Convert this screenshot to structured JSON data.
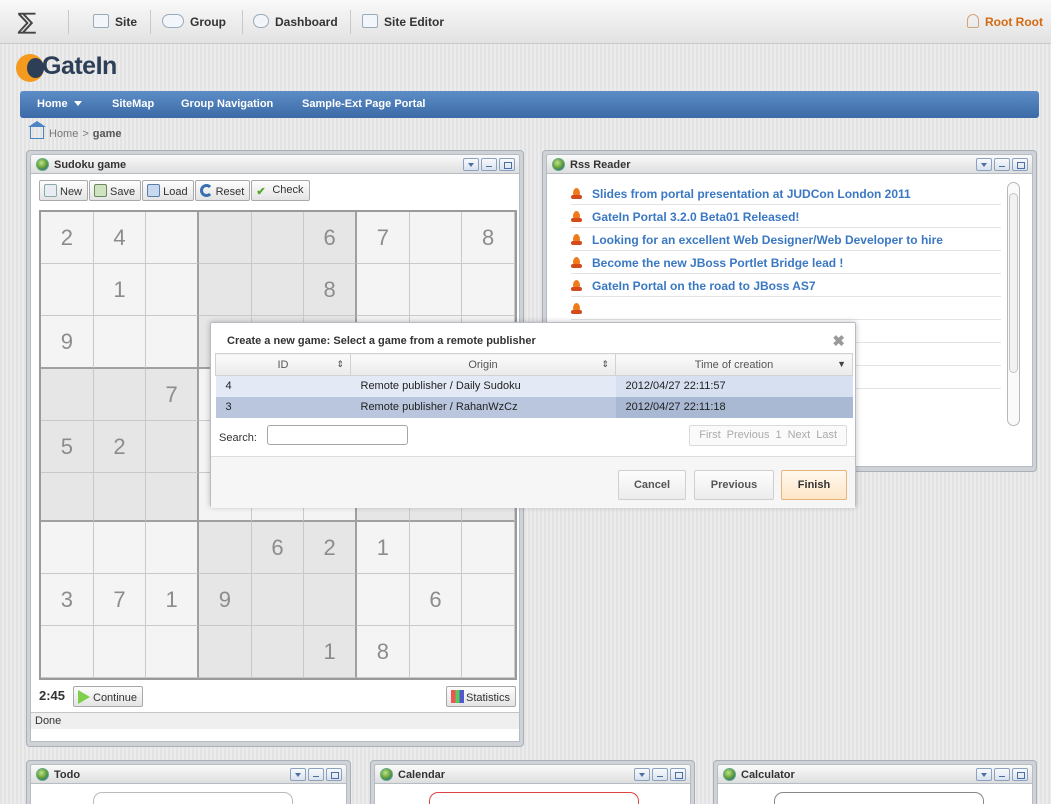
{
  "toolbar": {
    "items": [
      {
        "label": "Site",
        "icon": "site-icon"
      },
      {
        "label": "Group",
        "icon": "group-icon"
      },
      {
        "label": "Dashboard",
        "icon": "dashboard-icon"
      },
      {
        "label": "Site Editor",
        "icon": "site-editor-icon"
      }
    ],
    "user": "Root Root"
  },
  "brand": {
    "name": "GateIn"
  },
  "nav": {
    "items": [
      "Home",
      "SiteMap",
      "Group Navigation",
      "Sample-Ext Page Portal"
    ]
  },
  "breadcrumb": {
    "home": "Home",
    "separator": ">",
    "current": "game"
  },
  "sudoku": {
    "title": "Sudoku game",
    "buttons": [
      "New",
      "Save",
      "Load",
      "Reset",
      "Check"
    ],
    "grid": [
      [
        "2",
        "4",
        "",
        "",
        "",
        "6",
        "7",
        "",
        "8"
      ],
      [
        "",
        "1",
        "",
        "",
        "",
        "8",
        "",
        "",
        ""
      ],
      [
        "9",
        "",
        "",
        "",
        "",
        "",
        "",
        "",
        ""
      ],
      [
        "",
        "",
        "7",
        "",
        "",
        "",
        "",
        "",
        ""
      ],
      [
        "5",
        "2",
        "",
        "",
        "",
        "",
        "",
        "",
        ""
      ],
      [
        "",
        "",
        "",
        "",
        "",
        "",
        "",
        "",
        ""
      ],
      [
        "",
        "",
        "",
        "",
        "6",
        "2",
        "1",
        "",
        ""
      ],
      [
        "3",
        "7",
        "1",
        "9",
        "",
        "",
        "",
        "6",
        ""
      ],
      [
        "",
        "",
        "",
        "",
        "",
        "1",
        "8",
        "",
        ""
      ]
    ],
    "timer": "2:45",
    "continue_label": "Continue",
    "statistics_label": "Statistics",
    "status": "Done"
  },
  "rss": {
    "title": "Rss Reader",
    "items": [
      "Slides from portal presentation at JUDCon London 2011",
      "GateIn Portal 3.2.0 Beta01 Released!",
      "Looking for an excellent Web Designer/Web Developer to hire",
      "Become the new JBoss Portlet Bridge lead !",
      "GateIn Portal on the road to JBoss AS7",
      "",
      "ease!",
      "",
      "ter Developer?"
    ]
  },
  "bottom_portlets": [
    {
      "title": "Todo"
    },
    {
      "title": "Calendar"
    },
    {
      "title": "Calculator"
    }
  ],
  "modal": {
    "title": "Create a new game: Select a game from a remote publisher",
    "columns": [
      "ID",
      "Origin",
      "Time of creation"
    ],
    "rows": [
      {
        "id": "4",
        "origin": "Remote publisher / Daily Sudoku",
        "time": "2012/04/27 22:11:57"
      },
      {
        "id": "3",
        "origin": "Remote publisher / RahanWzCz",
        "time": "2012/04/27 22:11:18"
      }
    ],
    "search_label": "Search:",
    "search_value": "",
    "pager": [
      "First",
      "Previous",
      "1",
      "Next",
      "Last"
    ],
    "buttons": {
      "cancel": "Cancel",
      "previous": "Previous",
      "finish": "Finish"
    }
  },
  "colors": {
    "nav": "#4a7bb8",
    "link": "#3a78c3",
    "user": "#d36a11",
    "brand": "#2c3f57"
  }
}
